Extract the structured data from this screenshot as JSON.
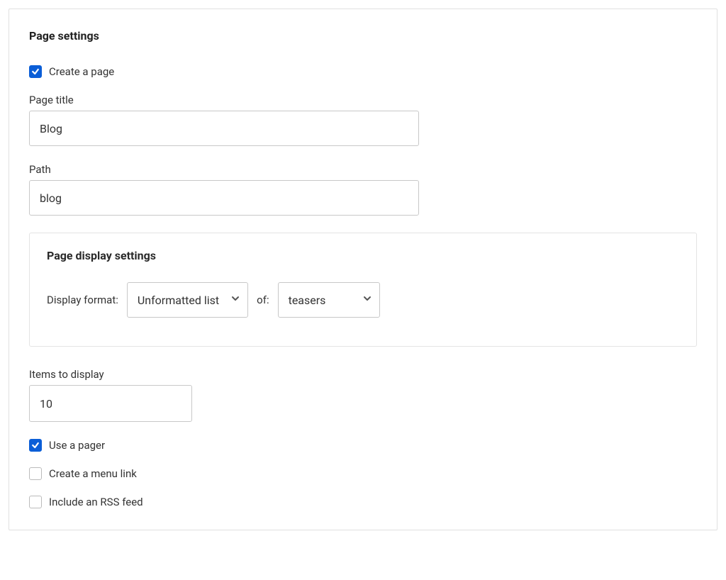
{
  "heading": "Page settings",
  "create_page": {
    "label": "Create a page",
    "checked": true
  },
  "page_title": {
    "label": "Page title",
    "value": "Blog"
  },
  "path": {
    "label": "Path",
    "value": "blog"
  },
  "display_settings": {
    "heading": "Page display settings",
    "format_label": "Display format:",
    "format_value": "Unformatted list",
    "of_label": "of:",
    "of_value": "teasers"
  },
  "items_to_display": {
    "label": "Items to display",
    "value": "10"
  },
  "use_pager": {
    "label": "Use a pager",
    "checked": true
  },
  "create_menu_link": {
    "label": "Create a menu link",
    "checked": false
  },
  "include_rss": {
    "label": "Include an RSS feed",
    "checked": false
  }
}
